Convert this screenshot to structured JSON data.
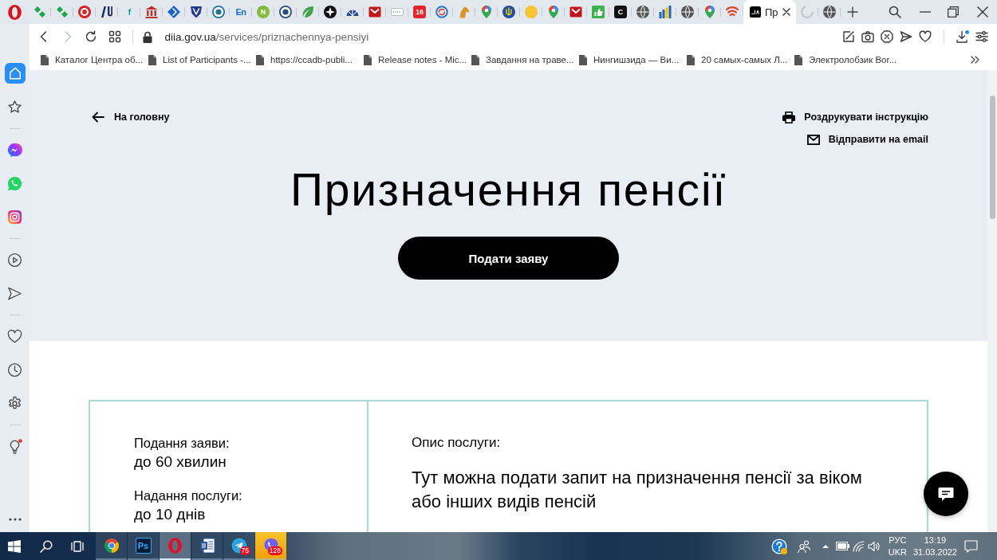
{
  "tab_strip": {
    "tabs": [
      {
        "kind": "diamond-pair",
        "color": "#1da84a",
        "selected": false
      },
      {
        "kind": "diamond-pair",
        "color": "#1da84a",
        "selected": false
      },
      {
        "kind": "ring-disc",
        "color": "#d8222a",
        "selected": false
      },
      {
        "kind": "bars-logo",
        "color": "#1c2a5e",
        "selected": false
      },
      {
        "kind": "letters",
        "color": "#1aa39e",
        "glyph": "f",
        "selected": false
      },
      {
        "kind": "columns",
        "color": "#b5352b",
        "selected": false
      },
      {
        "kind": "diamond",
        "color": "#1b67c8",
        "selected": false
      },
      {
        "kind": "shield",
        "color": "#23398c",
        "selected": false
      },
      {
        "kind": "circle-logo",
        "color": "#21759b",
        "selected": false
      },
      {
        "kind": "letters",
        "color": "#1a6ad0",
        "glyph": "En",
        "selected": false
      },
      {
        "kind": "glyph-disc",
        "color": "#86bc3c",
        "glyph": "N",
        "selected": false
      },
      {
        "kind": "circle-logo",
        "color": "#2b4a7c",
        "selected": false
      },
      {
        "kind": "leaf",
        "color": "#3da24b",
        "selected": false
      },
      {
        "kind": "compass-disc",
        "color": "#111111",
        "selected": false
      },
      {
        "kind": "fan",
        "color": "#27479a",
        "selected": false
      },
      {
        "kind": "tile-logo",
        "color": "#c3161c",
        "selected": false
      },
      {
        "kind": "blank-tile",
        "color": "#f8f9fb",
        "selected": false
      },
      {
        "kind": "tile",
        "color": "#e3262c",
        "glyph": "16",
        "selected": false
      },
      {
        "kind": "arrows-ring",
        "color": "#2a78c8",
        "selected": false
      },
      {
        "kind": "horse",
        "color": "#d8952a",
        "selected": false
      },
      {
        "kind": "pin",
        "color": "#34a853",
        "selected": false
      },
      {
        "kind": "emblem-disc",
        "color": "#1f4fa3",
        "selected": false
      },
      {
        "kind": "disc",
        "color": "#f6c437",
        "selected": false
      },
      {
        "kind": "pin",
        "color": "#34a853",
        "selected": false
      },
      {
        "kind": "tile-logo",
        "color": "#c3161c",
        "selected": false
      },
      {
        "kind": "thumb-tile",
        "color": "#3db24e",
        "selected": false
      },
      {
        "kind": "tile",
        "color": "#111111",
        "glyph": "C",
        "selected": false
      },
      {
        "kind": "globe",
        "color": "#555555",
        "selected": false
      },
      {
        "kind": "bar-chart",
        "color": "#2a64b5",
        "selected": false
      },
      {
        "kind": "globe",
        "color": "#555555",
        "selected": false
      },
      {
        "kind": "pin",
        "color": "#34a853",
        "selected": false
      },
      {
        "kind": "arcs",
        "color": "#e0452b",
        "selected": false
      },
      {
        "kind": "logo-tile",
        "color": "#000000",
        "title": "Пр",
        "selected": true
      },
      {
        "kind": "spinner",
        "color": "#c3c7cd",
        "selected": false
      },
      {
        "kind": "globe",
        "color": "#555555",
        "selected": false
      }
    ]
  },
  "address_bar": {
    "nav": [
      {
        "kind": "back",
        "disabled": false
      },
      {
        "kind": "forward",
        "disabled": true
      },
      {
        "kind": "reload",
        "disabled": false
      },
      {
        "kind": "tab-grid",
        "disabled": false
      }
    ],
    "host": "diia.gov.ua",
    "path": "/services/priznachennya-pensiyi",
    "tools": [
      {
        "kind": "snapshot",
        "notified": false
      },
      {
        "kind": "camera",
        "notified": false
      },
      {
        "kind": "adblock",
        "notified": false
      },
      {
        "kind": "send",
        "notified": false
      },
      {
        "kind": "heart",
        "notified": false
      },
      {
        "kind": "download",
        "notified": true
      },
      {
        "kind": "setup",
        "notified": false
      }
    ]
  },
  "bookmarks_bar": {
    "items": [
      "Каталог Центра об...",
      "List of Participants -...",
      "https://ccadb-publi...",
      "Release notes - Mic...",
      "Завдання на траве...",
      "Нингишзида — Ви...",
      "20 самых-самых Л...",
      "Электролобзик Bor..."
    ]
  },
  "sidebar": {
    "groups": [
      [
        {
          "kind": "home",
          "selected": true,
          "notified": false
        },
        {
          "kind": "star",
          "selected": false,
          "notified": false
        }
      ],
      [
        {
          "kind": "messenger",
          "selected": false,
          "notified": false
        },
        {
          "kind": "whatsapp",
          "selected": false,
          "notified": false
        },
        {
          "kind": "instagram",
          "selected": false,
          "notified": false
        }
      ],
      [
        {
          "kind": "player",
          "selected": false,
          "notified": false
        },
        {
          "kind": "send",
          "selected": false,
          "notified": false
        }
      ],
      [
        {
          "kind": "heart",
          "selected": false,
          "notified": false
        },
        {
          "kind": "history",
          "selected": false,
          "notified": false
        },
        {
          "kind": "settings",
          "selected": false,
          "notified": false
        }
      ],
      [
        {
          "kind": "bulb",
          "selected": false,
          "notified": true
        }
      ]
    ]
  },
  "page": {
    "back_link": "На головну",
    "actions": [
      {
        "kind": "print",
        "label": "Роздрукувати інструкцію"
      },
      {
        "kind": "email",
        "label": "Відправити на email"
      }
    ],
    "title": "Призначення пенсії",
    "apply_button": "Подати заяву",
    "info_card": {
      "facts": [
        {
          "label": "Подання заяви:",
          "value": "до 60 хвилин"
        },
        {
          "label": "Надання послуги:",
          "value": "до 10 днів"
        }
      ],
      "description_label": "Опис послуги:",
      "description": "Тут можна подати запит на призначення пенсії за віком або інших видів пенсій"
    }
  },
  "taskbar": {
    "apps": [
      {
        "kind": "chrome",
        "selected": false,
        "attention": false
      },
      {
        "kind": "photo-editor",
        "glyph": "Ps",
        "selected": false,
        "attention": false
      },
      {
        "kind": "opera",
        "selected": true,
        "attention": false
      },
      {
        "kind": "word",
        "selected": false,
        "attention": false
      },
      {
        "kind": "telegram",
        "badge": "75",
        "selected": false,
        "attention": false
      },
      {
        "kind": "viber",
        "badge": "128",
        "selected": false,
        "attention": true
      }
    ],
    "language": [
      "РУС",
      "UKR"
    ],
    "clock": {
      "time": "13:19",
      "date": "31.03.2022"
    }
  }
}
